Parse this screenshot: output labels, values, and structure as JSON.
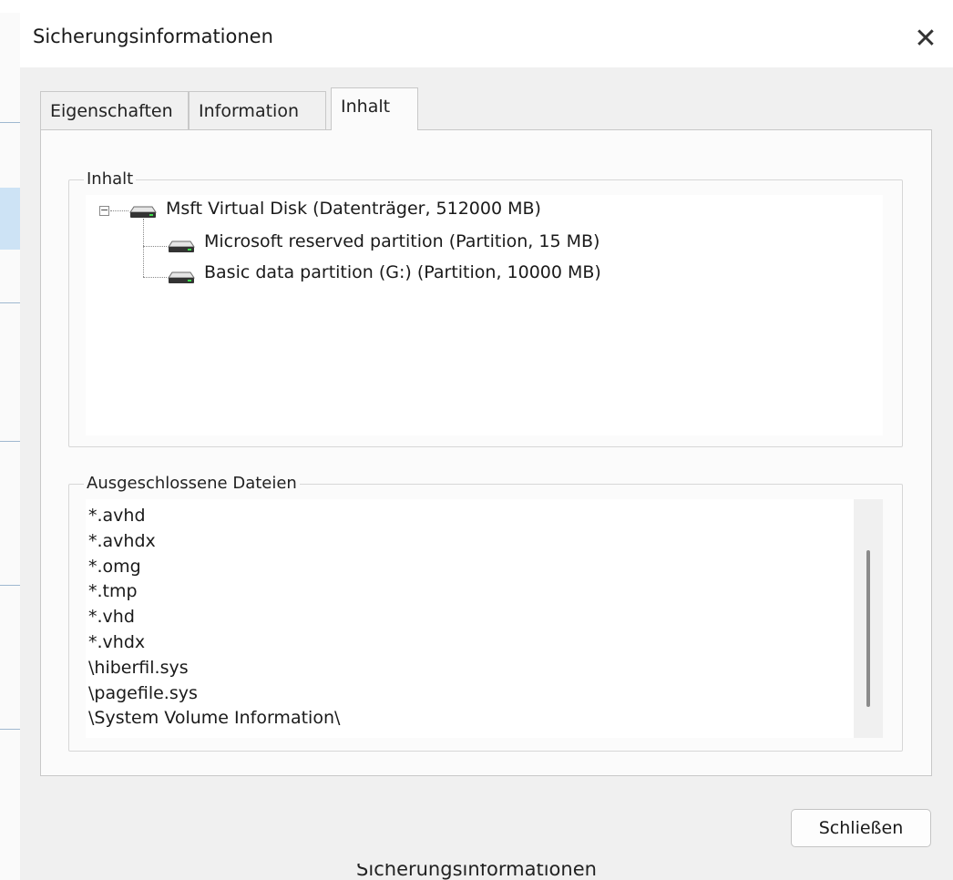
{
  "dialog": {
    "title": "Sicherungsinformationen",
    "close_glyph": "✕"
  },
  "tabs": [
    {
      "label": "Eigenschaften",
      "active": false
    },
    {
      "label": "Information",
      "active": false
    },
    {
      "label": "Inhalt",
      "active": true
    }
  ],
  "content_group": {
    "legend": "Inhalt",
    "tree": {
      "root": {
        "label": "Msft Virtual Disk (Datenträger, 512000 MB)",
        "expanded": true,
        "icon": "drive-icon"
      },
      "children": [
        {
          "label": "Microsoft reserved partition (Partition, 15 MB)",
          "icon": "drive-icon"
        },
        {
          "label": "Basic data partition (G:) (Partition, 10000 MB)",
          "icon": "drive-icon"
        }
      ]
    }
  },
  "excluded_group": {
    "legend": "Ausgeschlossene Dateien",
    "items": [
      "*.avhd",
      "*.avhdx",
      "*.omg",
      "*.tmp",
      "*.vhd",
      "*.vhdx",
      "\\hiberfil.sys",
      "\\pagefile.sys",
      "\\System Volume Information\\"
    ]
  },
  "buttons": {
    "close_label": "Schließen"
  },
  "taskbar": {
    "caption": "Sicherungsinformationen"
  }
}
